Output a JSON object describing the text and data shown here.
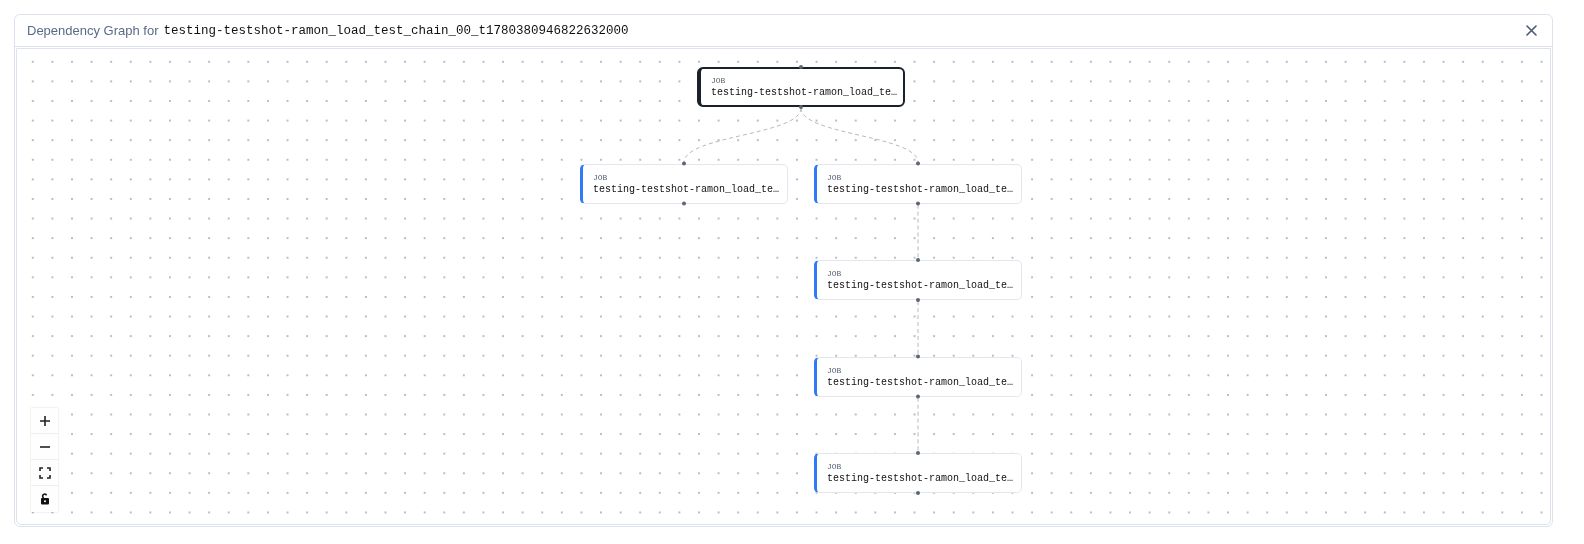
{
  "header": {
    "title": "Dependency Graph for",
    "graph_name": "testing-testshot-ramon_load_test_chain_00_t1780380946822632000"
  },
  "graph": {
    "root": {
      "label": "JOB",
      "name": "testing-testshot-ramon_load_te…",
      "selected": true,
      "children": [
        {
          "label": "JOB",
          "name": "testing-testshot-ramon_load_te…",
          "selected": false
        },
        {
          "label": "JOB",
          "name": "testing-testshot-ramon_load_te…",
          "selected": false,
          "children": [
            {
              "label": "JOB",
              "name": "testing-testshot-ramon_load_te…",
              "selected": false,
              "children": [
                {
                  "label": "JOB",
                  "name": "testing-testshot-ramon_load_te…",
                  "selected": false,
                  "children": [
                    {
                      "label": "JOB",
                      "name": "testing-testshot-ramon_load_te…",
                      "selected": false
                    }
                  ]
                }
              ]
            }
          ]
        }
      ]
    }
  },
  "controls": [
    {
      "kind": "zoom-in"
    },
    {
      "kind": "zoom-out"
    },
    {
      "kind": "fit"
    },
    {
      "kind": "lock"
    }
  ]
}
